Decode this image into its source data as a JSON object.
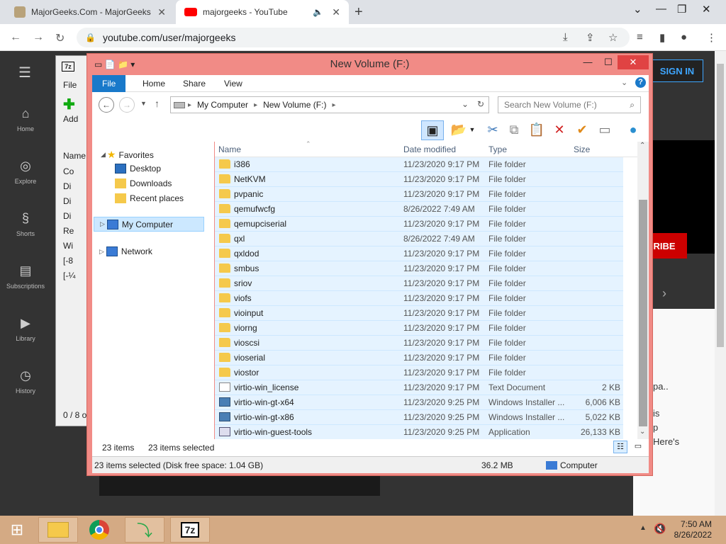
{
  "browser": {
    "tabs": [
      {
        "title": "MajorGeeks.Com - MajorGeeks",
        "active": false
      },
      {
        "title": "majorgeeks - YouTube",
        "active": true
      }
    ],
    "url": "youtube.com/user/majorgeeks"
  },
  "youtube": {
    "sidebar": [
      "Home",
      "Explore",
      "Shorts",
      "Subscriptions",
      "Library",
      "History"
    ],
    "sign_in": "SIGN IN",
    "subscribe_fragment": "RIBE",
    "side_text": [
      "pa..",
      "is",
      "p",
      "Here's"
    ]
  },
  "sevenzip": {
    "menu_file": "File",
    "add_label": "Add",
    "col_name": "Name",
    "rows": [
      "Co",
      "Di",
      "Di",
      "Di",
      "Re",
      "Wi",
      "[-8",
      "[-¼"
    ],
    "status": "0 / 8 o"
  },
  "explorer": {
    "title": "New Volume (F:)",
    "ribbon_tabs": [
      "File",
      "Home",
      "Share",
      "View"
    ],
    "breadcrumb": [
      "My Computer",
      "New Volume (F:)"
    ],
    "search_placeholder": "Search New Volume (F:)",
    "nav": {
      "favorites": "Favorites",
      "desktop": "Desktop",
      "downloads": "Downloads",
      "recent": "Recent places",
      "mycomputer": "My Computer",
      "network": "Network"
    },
    "columns": [
      "Name",
      "Date modified",
      "Type",
      "Size"
    ],
    "files": [
      {
        "name": "i386",
        "date": "11/23/2020 9:17 PM",
        "type": "File folder",
        "size": "",
        "kind": "folder"
      },
      {
        "name": "NetKVM",
        "date": "11/23/2020 9:17 PM",
        "type": "File folder",
        "size": "",
        "kind": "folder"
      },
      {
        "name": "pvpanic",
        "date": "11/23/2020 9:17 PM",
        "type": "File folder",
        "size": "",
        "kind": "folder"
      },
      {
        "name": "qemufwcfg",
        "date": "8/26/2022 7:49 AM",
        "type": "File folder",
        "size": "",
        "kind": "folder"
      },
      {
        "name": "qemupciserial",
        "date": "11/23/2020 9:17 PM",
        "type": "File folder",
        "size": "",
        "kind": "folder"
      },
      {
        "name": "qxl",
        "date": "8/26/2022 7:49 AM",
        "type": "File folder",
        "size": "",
        "kind": "folder"
      },
      {
        "name": "qxldod",
        "date": "11/23/2020 9:17 PM",
        "type": "File folder",
        "size": "",
        "kind": "folder"
      },
      {
        "name": "smbus",
        "date": "11/23/2020 9:17 PM",
        "type": "File folder",
        "size": "",
        "kind": "folder"
      },
      {
        "name": "sriov",
        "date": "11/23/2020 9:17 PM",
        "type": "File folder",
        "size": "",
        "kind": "folder"
      },
      {
        "name": "viofs",
        "date": "11/23/2020 9:17 PM",
        "type": "File folder",
        "size": "",
        "kind": "folder"
      },
      {
        "name": "vioinput",
        "date": "11/23/2020 9:17 PM",
        "type": "File folder",
        "size": "",
        "kind": "folder"
      },
      {
        "name": "viorng",
        "date": "11/23/2020 9:17 PM",
        "type": "File folder",
        "size": "",
        "kind": "folder"
      },
      {
        "name": "vioscsi",
        "date": "11/23/2020 9:17 PM",
        "type": "File folder",
        "size": "",
        "kind": "folder"
      },
      {
        "name": "vioserial",
        "date": "11/23/2020 9:17 PM",
        "type": "File folder",
        "size": "",
        "kind": "folder"
      },
      {
        "name": "viostor",
        "date": "11/23/2020 9:17 PM",
        "type": "File folder",
        "size": "",
        "kind": "folder"
      },
      {
        "name": "virtio-win_license",
        "date": "11/23/2020 9:17 PM",
        "type": "Text Document",
        "size": "2 KB",
        "kind": "doc"
      },
      {
        "name": "virtio-win-gt-x64",
        "date": "11/23/2020 9:25 PM",
        "type": "Windows Installer ...",
        "size": "6,006 KB",
        "kind": "msi"
      },
      {
        "name": "virtio-win-gt-x86",
        "date": "11/23/2020 9:25 PM",
        "type": "Windows Installer ...",
        "size": "5,022 KB",
        "kind": "msi"
      },
      {
        "name": "virtio-win-guest-tools",
        "date": "11/23/2020 9:25 PM",
        "type": "Application",
        "size": "26,133 KB",
        "kind": "app"
      }
    ],
    "items_count": "23 items",
    "items_selected": "23 items selected",
    "status_left": "23 items selected (Disk free space: 1.04 GB)",
    "status_size": "36.2 MB",
    "status_location": "Computer"
  },
  "taskbar": {
    "time": "7:50 AM",
    "date": "8/26/2022",
    "sevenzip_label": "7z"
  },
  "colors": {
    "explorer_frame": "#f18b86",
    "ribbon_file": "#1979ca",
    "selection": "#e5f3ff",
    "taskbar": "#d4aa84"
  }
}
